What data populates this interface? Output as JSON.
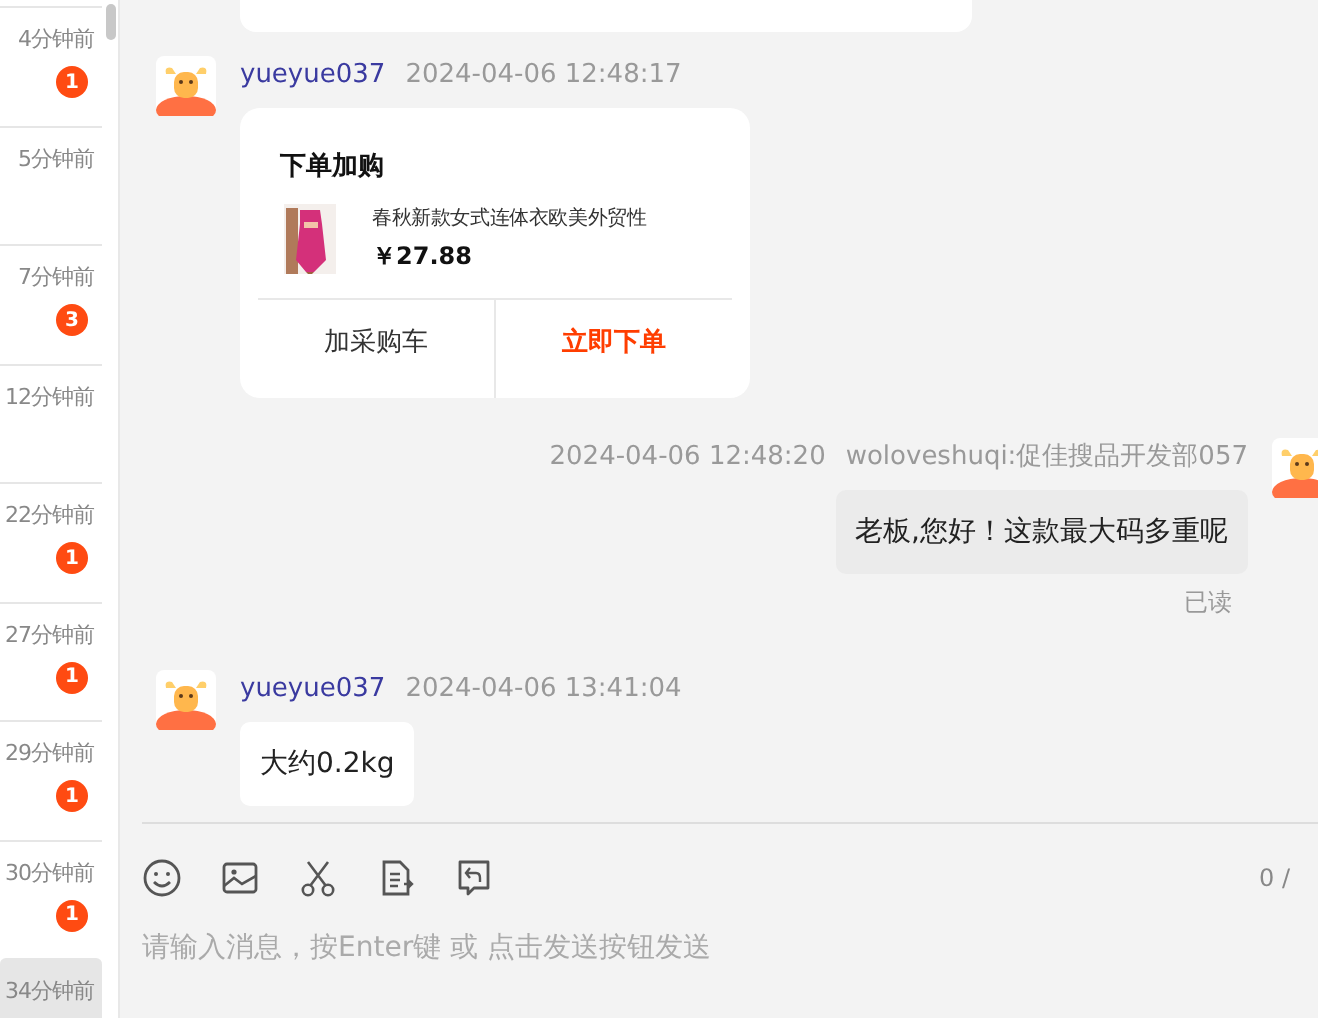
{
  "sidebar": {
    "items": [
      {
        "time": "4分钟前",
        "unread": "1",
        "selected": false
      },
      {
        "time": "5分钟前",
        "selected": false
      },
      {
        "time": "7分钟前",
        "unread": "3",
        "selected": false
      },
      {
        "time": "12分钟前",
        "selected": false
      },
      {
        "time": "22分钟前",
        "unread": "1",
        "selected": false
      },
      {
        "time": "27分钟前",
        "unread": "1",
        "selected": false
      },
      {
        "time": "29分钟前",
        "unread": "1",
        "selected": false
      },
      {
        "time": "30分钟前",
        "unread": "1",
        "selected": false
      },
      {
        "time": "34分钟前",
        "selected": true
      }
    ]
  },
  "messages": [
    {
      "kind": "card",
      "outgoing": false,
      "sender": "yueyue037",
      "time": "2024-04-06 12:48:17",
      "card": {
        "title": "下单加购",
        "product": "春秋新款女式连体衣欧美外贸性",
        "price": "￥27.88",
        "buttons": [
          {
            "label": "加采购车",
            "primary": false
          },
          {
            "label": "立即下单",
            "primary": true
          }
        ]
      }
    },
    {
      "kind": "text",
      "outgoing": true,
      "sender": "woloveshuqi:促佳搜品开发部057",
      "time": "2024-04-06 12:48:20",
      "text": "老板,您好！这款最大码多重呢",
      "status": "已读"
    },
    {
      "kind": "text",
      "outgoing": false,
      "sender": "yueyue037",
      "time": "2024-04-06 13:41:04",
      "text": "大约0.2kg"
    }
  ],
  "composer": {
    "counter": "0 /",
    "placeholder": "请输入消息，按Enter键 或 点击发送按钮发送"
  }
}
